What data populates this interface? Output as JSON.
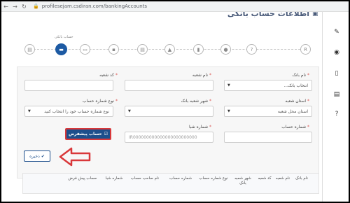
{
  "browser": {
    "url": "profilesejam.csdiran.com/bankingAccounts"
  },
  "page": {
    "title": "اطلاعات حساب بانکی"
  },
  "stepper": {
    "active_label": "حساب بانکی",
    "steps": [
      "R",
      "?",
      "person",
      "flag",
      "grad",
      "pos",
      "work",
      "card",
      "bank",
      "doc"
    ]
  },
  "form": {
    "bank_name": {
      "label": "نام بانک",
      "value": "انتخاب بانک..."
    },
    "branch_name": {
      "label": "نام شعبه",
      "value": ""
    },
    "branch_code": {
      "label": "کد شعبه",
      "value": ""
    },
    "branch_province": {
      "label": "استان شعبه",
      "value": "استان محل شعبه"
    },
    "branch_city": {
      "label": "شهر شعبه بانک",
      "value": ""
    },
    "account_type": {
      "label": "نوع شماره حساب",
      "value": "نوع شماره حساب خود را انتخاب کنید"
    },
    "account_number": {
      "label": "شماره حساب",
      "value": ""
    },
    "sheba": {
      "label": "شماره شبا",
      "value": "IR000000000000000000000000"
    },
    "default_button": "حساب پیشفرض",
    "save_button": "ذخیره"
  },
  "table": {
    "headers": [
      "نام بانک",
      "نام شعبه",
      "کد شعبه",
      "شهر شعبه بانک",
      "نوع شماره حساب",
      "شماره حساب",
      "نام صاحب حساب",
      "شماره شبا",
      "حساب پیش فرض"
    ]
  },
  "colors": {
    "primary": "#1d4f8c",
    "accent_red": "#d9383a",
    "required": "#d9534f"
  }
}
